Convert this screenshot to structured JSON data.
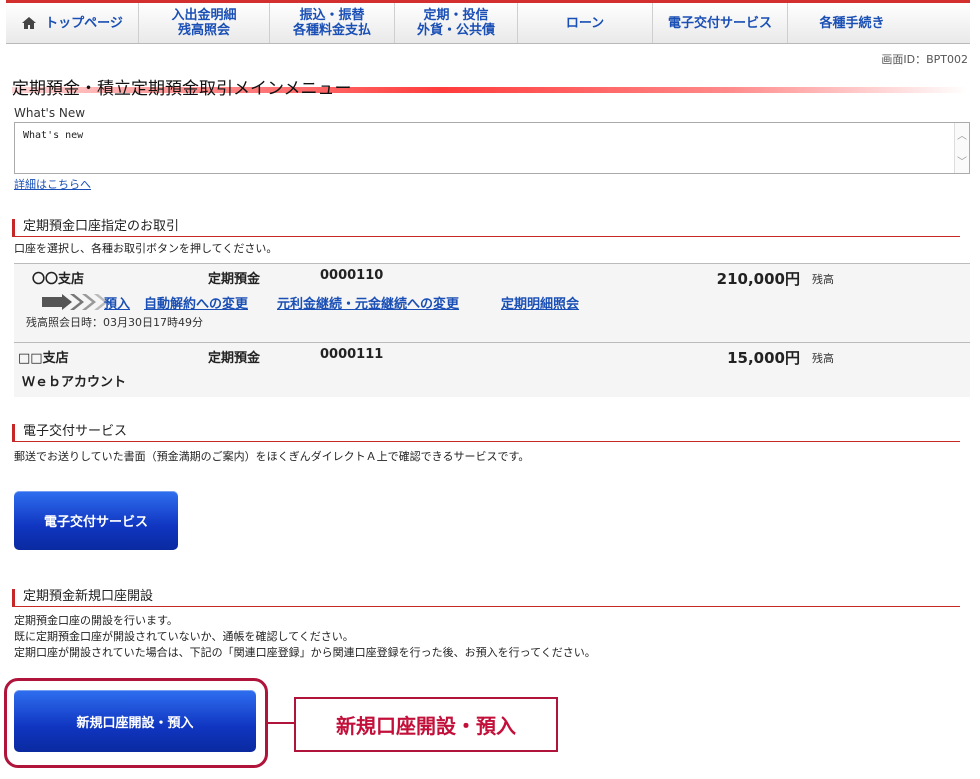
{
  "nav": {
    "items": [
      {
        "label": "トップページ",
        "icon": "home-icon"
      },
      {
        "label": "入出金明細\n残高照会"
      },
      {
        "label": "振込・振替\n各種料金支払"
      },
      {
        "label": "定期・投信\n外貨・公共債"
      },
      {
        "label": "ローン"
      },
      {
        "label": "電子交付サービス"
      },
      {
        "label": "各種手続き"
      }
    ],
    "accent_color": "#d32f2f",
    "link_color": "#1a4fb5"
  },
  "screen_id": "画面ID：BPT002",
  "page_title": "定期預金・積立定期預金取引メインメニュー",
  "whats_new": {
    "label": "What's New",
    "content": "What's new",
    "details_link": "詳細はこちらへ"
  },
  "account_section": {
    "heading": "定期預金口座指定のお取引",
    "instruction": "口座を選択し、各種お取引ボタンを押してください。",
    "accounts": [
      {
        "branch": "〇〇支店",
        "type": "定期預金",
        "number": "0000110",
        "amount": "210,000円",
        "balance_label": "残高",
        "actions": [
          "預入",
          "自動解約への変更",
          "元利金継続・元金継続への変更",
          "定期明細照会"
        ],
        "timestamp": "残高照会日時：03月30日17時49分"
      },
      {
        "branch": "□□支店",
        "type": "定期預金",
        "number": "0000111",
        "amount": "15,000円",
        "balance_label": "残高",
        "sub_label": "Ｗｅｂアカウント"
      }
    ]
  },
  "e_delivery": {
    "heading": "電子交付サービス",
    "description": "郵送でお送りしていた書面（預金満期のご案内）をほくぎんダイレクトＡ上で確認できるサービスです。",
    "button_label": "電子交付サービス"
  },
  "new_account": {
    "heading": "定期預金新規口座開設",
    "notes": [
      "定期預金口座の開設を行います。",
      "既に定期預金口座が開設されていないか、通帳を確認してください。",
      "定期口座が開設されていた場合は、下記の「関連口座登録」から関連口座登録を行った後、お預入を行ってください。"
    ],
    "button_label": "新規口座開設・預入",
    "callout": "新規口座開設・預入",
    "callout_color": "#b0143b"
  }
}
